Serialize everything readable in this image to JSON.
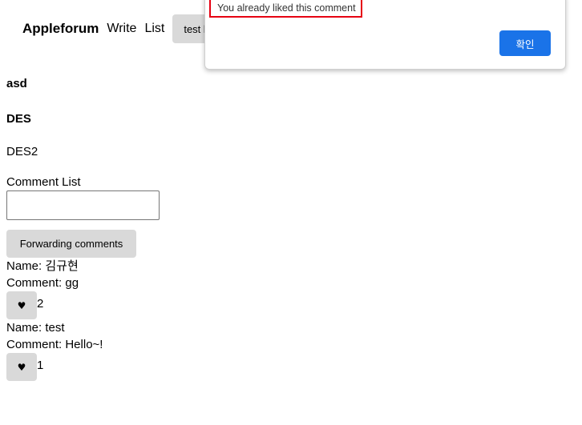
{
  "nav": {
    "brand": "Appleforum",
    "write": "Write",
    "list": "List",
    "user_button": "test l"
  },
  "post": {
    "title": "asd",
    "subtitle": "DES",
    "content": "DES2"
  },
  "comments": {
    "list_label": "Comment List",
    "input_value": "",
    "forward_button": "Forwarding comments",
    "items": [
      {
        "name": "Name: 김규현",
        "comment": "Comment: gg",
        "like_icon": "♥",
        "likes": "2"
      },
      {
        "name": "Name: test",
        "comment": "Comment: Hello~!",
        "like_icon": "♥",
        "likes": "1"
      }
    ]
  },
  "dialog": {
    "message": "You already liked this comment",
    "ok_button": "확인"
  },
  "colors": {
    "accent": "#1a73e8",
    "highlight_border": "#e60012",
    "button_gray": "#d9d9d9"
  }
}
